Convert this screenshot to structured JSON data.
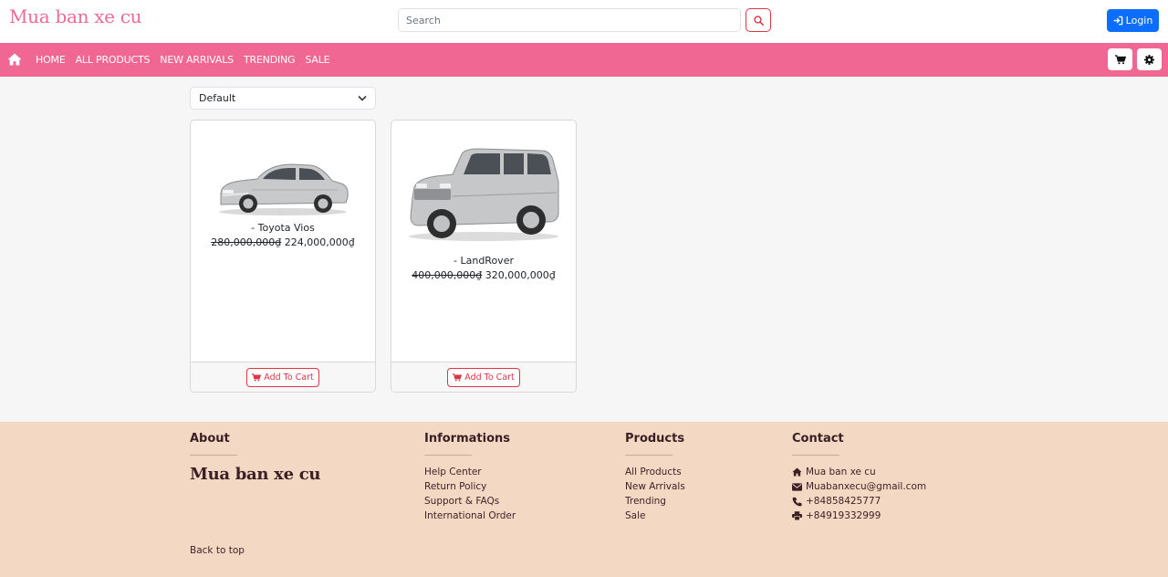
{
  "header": {
    "brand": "Mua ban xe cu",
    "search_placeholder": "Search",
    "login_label": "Login"
  },
  "nav": {
    "links": [
      "HOME",
      "ALL PRODUCTS",
      "NEW ARRIVALS",
      "TRENDING",
      "SALE"
    ]
  },
  "sort": {
    "selected": "Default"
  },
  "products": [
    {
      "name": "- Toyota Vios",
      "old_price": "280,000,000₫",
      "price": "224,000,000₫",
      "button": "Add To Cart"
    },
    {
      "name": "- LandRover",
      "old_price": "400,000,000₫",
      "price": "320,000,000₫",
      "button": "Add To Cart"
    }
  ],
  "footer": {
    "about": {
      "heading": "About",
      "brand": "Mua ban xe cu"
    },
    "informations": {
      "heading": "Informations",
      "links": [
        "Help Center",
        "Return Policy",
        "Support & FAQs",
        "International Order"
      ]
    },
    "products": {
      "heading": "Products",
      "links": [
        "All Products",
        "New Arrivals",
        "Trending",
        "Sale"
      ]
    },
    "contact": {
      "heading": "Contact",
      "items": [
        {
          "icon": "home-icon",
          "text": "Mua ban xe cu"
        },
        {
          "icon": "envelope-icon",
          "text": "Muabanxecu@gmail.com"
        },
        {
          "icon": "phone-icon",
          "text": "+84858425777"
        },
        {
          "icon": "printer-icon",
          "text": "+84919332999"
        }
      ]
    },
    "back_to_top": "Back to top"
  },
  "colors": {
    "brand_pink": "#ee6b91",
    "nav_pink": "#f06794",
    "login_blue": "#0d6efd",
    "danger_red": "#dc3545",
    "footer_bg": "#f3d9c4"
  }
}
